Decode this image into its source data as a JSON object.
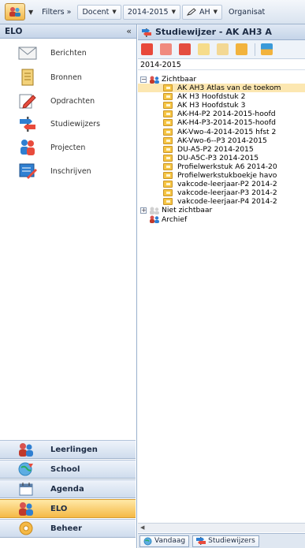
{
  "toolbar": {
    "filters_label": "Filters »",
    "docent_label": "Docent",
    "year_label": "2014-2015",
    "ah_label": "AH",
    "organisation_label": "Organisat"
  },
  "sidebar": {
    "title": "ELO",
    "collapse_glyph": "«",
    "items": [
      {
        "label": "Berichten",
        "icon": "envelope-icon"
      },
      {
        "label": "Bronnen",
        "icon": "document-icon"
      },
      {
        "label": "Opdrachten",
        "icon": "pencil-icon"
      },
      {
        "label": "Studiewijzers",
        "icon": "signpost-icon"
      },
      {
        "label": "Projecten",
        "icon": "people-icon"
      },
      {
        "label": "Inschrijven",
        "icon": "register-icon"
      }
    ],
    "nav": [
      {
        "label": "Leerlingen",
        "icon": "students-icon"
      },
      {
        "label": "School",
        "icon": "school-icon"
      },
      {
        "label": "Agenda",
        "icon": "calendar-icon"
      },
      {
        "label": "ELO",
        "icon": "elo-icon",
        "active": true
      },
      {
        "label": "Beheer",
        "icon": "gear-icon"
      }
    ]
  },
  "main": {
    "title": "Studiewijzer - AK AH3 A",
    "year": "2014-2015",
    "tree": {
      "visible_group": "Zichtbaar",
      "items": [
        "AK AH3 Atlas van de toekom",
        "AK H3 Hoofdstuk 2",
        "AK H3 Hoofdstuk 3",
        "AK-H4-P2 2014-2015-hoofd",
        "AK-H4-P3-2014-2015-hoofd",
        "AK-Vwo-4-2014-2015 hfst 2",
        "AK-Vwo-6--P3 2014-2015",
        "DU-A5-P2 2014-2015",
        "DU-A5C-P3 2014-2015",
        "Profielwerkstuk A6 2014-20",
        "Profielwerkstukboekje havo",
        "vakcode-leerjaar-P2 2014-2",
        "vakcode-leerjaar-P3 2014-2",
        "vakcode-leerjaar-P4 2014-2"
      ],
      "hidden_group": "Niet zichtbaar",
      "archive": "Archief"
    },
    "tabs": [
      "Vandaag",
      "Studiewijzers"
    ]
  },
  "colors": {
    "accent": "#f5b946",
    "selected_row": "#fce7b1",
    "header": "#c5d4e8"
  }
}
